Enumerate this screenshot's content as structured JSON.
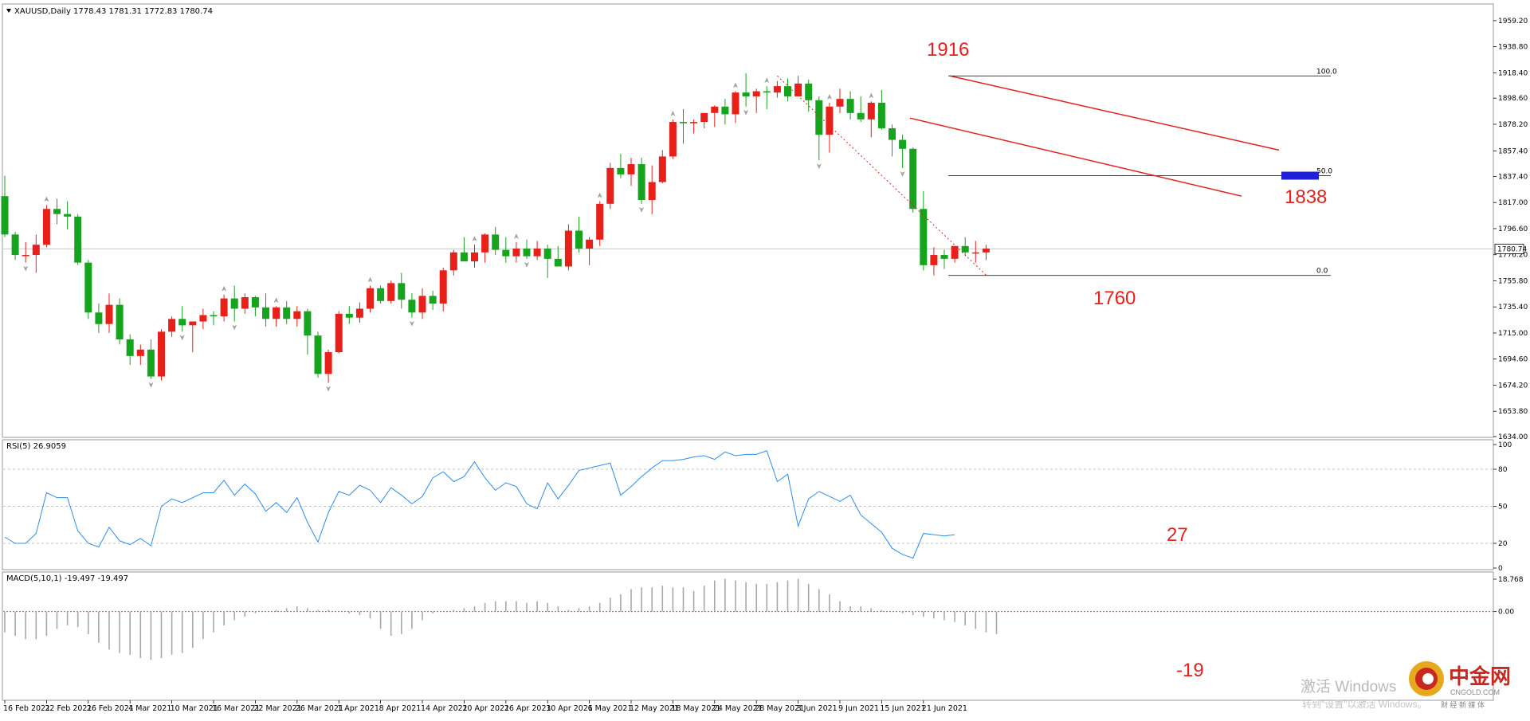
{
  "header": {
    "symbol_timeframe": "XAUUSD,Daily",
    "ohlc": "1778.43 1781.31 1772.83 1780.74"
  },
  "rsi_label": "RSI(5) 26.9059",
  "macd_label": "MACD(5,10,1) -19.497 -19.497",
  "current_price_label": "1780.74",
  "fib_levels": [
    {
      "label": "100.0",
      "price": 1916
    },
    {
      "label": "50.0",
      "price": 1838
    },
    {
      "label": "0.0",
      "price": 1760
    }
  ],
  "annotations": {
    "high": "1916",
    "target": "1838",
    "low": "1760",
    "rsi_value": "27",
    "macd_value": "-19"
  },
  "watermark": {
    "line1": "激活 Windows",
    "line2": "转到\"设置\"以激活 Windows。"
  },
  "logo": {
    "name": "中金网",
    "sub": "CNGOLD.COM",
    "tagline": "财 经 新 媒 体"
  },
  "colors": {
    "up": "#e8201a",
    "down": "#16a31d",
    "trend_line": "#e8201a",
    "rsi_line": "#2a8ef0",
    "target_box": "#1f1fd8"
  },
  "chart_data": {
    "type": "candlestick",
    "symbol": "XAUUSD",
    "timeframe": "Daily",
    "price_axis_ticks": [
      "1959.20",
      "1938.80",
      "1918.40",
      "1898.60",
      "1878.20",
      "1857.40",
      "1837.40",
      "1817.00",
      "1796.60",
      "1776.20",
      "1755.80",
      "1735.40",
      "1715.00",
      "1694.60",
      "1674.20",
      "1653.80",
      "1634.00"
    ],
    "ylim": [
      1634,
      1966
    ],
    "date_ticks": [
      {
        "label": "16 Feb 2021",
        "index": 0
      },
      {
        "label": "22 Feb 2021",
        "index": 4
      },
      {
        "label": "26 Feb 2021",
        "index": 8
      },
      {
        "label": "4 Mar 2021",
        "index": 12
      },
      {
        "label": "10 Mar 2021",
        "index": 16
      },
      {
        "label": "16 Mar 2021",
        "index": 20
      },
      {
        "label": "22 Mar 2021",
        "index": 24
      },
      {
        "label": "26 Mar 2021",
        "index": 28
      },
      {
        "label": "1 Apr 2021",
        "index": 32
      },
      {
        "label": "8 Apr 2021",
        "index": 36
      },
      {
        "label": "14 Apr 2021",
        "index": 40
      },
      {
        "label": "20 Apr 2021",
        "index": 44
      },
      {
        "label": "26 Apr 2021",
        "index": 48
      },
      {
        "label": "30 Apr 2021",
        "index": 52
      },
      {
        "label": "6 May 2021",
        "index": 56
      },
      {
        "label": "12 May 2021",
        "index": 60
      },
      {
        "label": "18 May 2021",
        "index": 64
      },
      {
        "label": "24 May 2021",
        "index": 68
      },
      {
        "label": "28 May 2021",
        "index": 72
      },
      {
        "label": "3 Jun 2021",
        "index": 76
      },
      {
        "label": "9 Jun 2021",
        "index": 80
      },
      {
        "label": "15 Jun 2021",
        "index": 84
      },
      {
        "label": "21 Jun 2021",
        "index": 88
      }
    ],
    "candles": [
      [
        1822,
        1838,
        1790,
        1792
      ],
      [
        1792,
        1794,
        1772,
        1776
      ],
      [
        1776,
        1786,
        1770,
        1776
      ],
      [
        1776,
        1792,
        1762,
        1784
      ],
      [
        1784,
        1815,
        1782,
        1812
      ],
      [
        1812,
        1820,
        1800,
        1808
      ],
      [
        1808,
        1818,
        1796,
        1806
      ],
      [
        1806,
        1808,
        1768,
        1770
      ],
      [
        1770,
        1772,
        1726,
        1731
      ],
      [
        1731,
        1738,
        1715,
        1722
      ],
      [
        1722,
        1746,
        1715,
        1737
      ],
      [
        1737,
        1742,
        1706,
        1710
      ],
      [
        1710,
        1714,
        1690,
        1697
      ],
      [
        1697,
        1706,
        1690,
        1702
      ],
      [
        1702,
        1710,
        1679,
        1681
      ],
      [
        1681,
        1718,
        1678,
        1716
      ],
      [
        1716,
        1728,
        1712,
        1726
      ],
      [
        1726,
        1736,
        1716,
        1721
      ],
      [
        1721,
        1724,
        1700,
        1724
      ],
      [
        1724,
        1734,
        1718,
        1729
      ],
      [
        1729,
        1732,
        1721,
        1728
      ],
      [
        1728,
        1745,
        1724,
        1742
      ],
      [
        1742,
        1752,
        1724,
        1734
      ],
      [
        1734,
        1746,
        1730,
        1743
      ],
      [
        1743,
        1744,
        1728,
        1735
      ],
      [
        1735,
        1746,
        1720,
        1726
      ],
      [
        1726,
        1736,
        1720,
        1735
      ],
      [
        1735,
        1740,
        1722,
        1726
      ],
      [
        1726,
        1736,
        1720,
        1732
      ],
      [
        1732,
        1734,
        1698,
        1713
      ],
      [
        1713,
        1716,
        1680,
        1683
      ],
      [
        1683,
        1702,
        1676,
        1700
      ],
      [
        1700,
        1732,
        1699,
        1730
      ],
      [
        1730,
        1736,
        1722,
        1727
      ],
      [
        1727,
        1739,
        1723,
        1734
      ],
      [
        1734,
        1752,
        1731,
        1750
      ],
      [
        1750,
        1752,
        1738,
        1740
      ],
      [
        1740,
        1756,
        1738,
        1754
      ],
      [
        1754,
        1762,
        1734,
        1741
      ],
      [
        1741,
        1746,
        1727,
        1731
      ],
      [
        1731,
        1750,
        1726,
        1744
      ],
      [
        1744,
        1748,
        1733,
        1738
      ],
      [
        1738,
        1766,
        1732,
        1764
      ],
      [
        1764,
        1780,
        1760,
        1778
      ],
      [
        1778,
        1790,
        1771,
        1771
      ],
      [
        1771,
        1784,
        1766,
        1778
      ],
      [
        1778,
        1793,
        1770,
        1792
      ],
      [
        1792,
        1798,
        1776,
        1780
      ],
      [
        1780,
        1790,
        1770,
        1775
      ],
      [
        1775,
        1786,
        1770,
        1781
      ],
      [
        1781,
        1788,
        1773,
        1775
      ],
      [
        1775,
        1787,
        1772,
        1781
      ],
      [
        1781,
        1784,
        1758,
        1773
      ],
      [
        1773,
        1783,
        1767,
        1767
      ],
      [
        1767,
        1800,
        1764,
        1795
      ],
      [
        1795,
        1806,
        1778,
        1781
      ],
      [
        1781,
        1790,
        1768,
        1788
      ],
      [
        1788,
        1818,
        1783,
        1816
      ],
      [
        1816,
        1848,
        1812,
        1844
      ],
      [
        1844,
        1855,
        1836,
        1839
      ],
      [
        1839,
        1852,
        1830,
        1847
      ],
      [
        1847,
        1852,
        1816,
        1819
      ],
      [
        1819,
        1846,
        1808,
        1833
      ],
      [
        1833,
        1858,
        1832,
        1853
      ],
      [
        1853,
        1882,
        1851,
        1880
      ],
      [
        1880,
        1890,
        1863,
        1879
      ],
      [
        1879,
        1882,
        1871,
        1880
      ],
      [
        1880,
        1886,
        1875,
        1887
      ],
      [
        1887,
        1893,
        1876,
        1892
      ],
      [
        1892,
        1898,
        1878,
        1886
      ],
      [
        1886,
        1904,
        1879,
        1903
      ],
      [
        1903,
        1918,
        1892,
        1900
      ],
      [
        1900,
        1906,
        1887,
        1904
      ],
      [
        1904,
        1908,
        1890,
        1903
      ],
      [
        1903,
        1912,
        1899,
        1908
      ],
      [
        1908,
        1914,
        1896,
        1900
      ],
      [
        1900,
        1916,
        1900,
        1910
      ],
      [
        1910,
        1913,
        1888,
        1897
      ],
      [
        1897,
        1900,
        1850,
        1870
      ],
      [
        1870,
        1895,
        1856,
        1892
      ],
      [
        1892,
        1906,
        1887,
        1898
      ],
      [
        1898,
        1904,
        1882,
        1887
      ],
      [
        1887,
        1900,
        1880,
        1882
      ],
      [
        1882,
        1896,
        1868,
        1895
      ],
      [
        1895,
        1905,
        1874,
        1875
      ],
      [
        1875,
        1878,
        1853,
        1866
      ],
      [
        1866,
        1870,
        1844,
        1859
      ],
      [
        1859,
        1860,
        1809,
        1812
      ],
      [
        1812,
        1826,
        1764,
        1768
      ],
      [
        1768,
        1782,
        1760,
        1776
      ],
      [
        1776,
        1780,
        1765,
        1773
      ],
      [
        1773,
        1783,
        1770,
        1783
      ],
      [
        1783,
        1790,
        1775,
        1778
      ],
      [
        1778,
        1787,
        1770,
        1778
      ],
      [
        1778,
        1784,
        1772,
        1781
      ]
    ],
    "rsi": {
      "name": "RSI(5)",
      "levels": [
        20,
        50,
        80
      ],
      "ylim": [
        0,
        100
      ],
      "tick_labels": [
        "100",
        "80",
        "50",
        "20",
        "0"
      ],
      "values": [
        25,
        20,
        20,
        28,
        61,
        57,
        57,
        30,
        20,
        17,
        33,
        22,
        19,
        24,
        18,
        50,
        56,
        53,
        57,
        61,
        61,
        71,
        59,
        68,
        60,
        46,
        53,
        45,
        57,
        37,
        21,
        45,
        62,
        59,
        67,
        63,
        53,
        65,
        59,
        52,
        58,
        73,
        78,
        70,
        74,
        86,
        73,
        63,
        69,
        66,
        52,
        48,
        69,
        56,
        67,
        79,
        81,
        83,
        85,
        59,
        66,
        74,
        81,
        87,
        87,
        88,
        90,
        91,
        88,
        94,
        91,
        92,
        92,
        95,
        70,
        76,
        34,
        56,
        62,
        58,
        54,
        59,
        43,
        36,
        29,
        16,
        11,
        8,
        28,
        27,
        26,
        27
      ]
    },
    "macd": {
      "name": "MACD(5,10,1)",
      "ylim": [
        -50,
        18.768
      ],
      "tick_labels": [
        "18.768",
        "0.00"
      ],
      "values": [
        -12,
        -14,
        -16,
        -16,
        -14,
        -10,
        -8,
        -9,
        -13,
        -18,
        -22,
        -24,
        -25,
        -27,
        -28,
        -27,
        -25,
        -24,
        -21,
        -16,
        -12,
        -8,
        -5,
        -3,
        -1,
        0,
        1,
        2,
        3,
        2,
        1,
        1,
        0,
        -1,
        -2,
        -4,
        -10,
        -14,
        -13,
        -10,
        -5,
        -1,
        0,
        1,
        2,
        3,
        5,
        6,
        6,
        6,
        5,
        6,
        5,
        3,
        1,
        2,
        3,
        5,
        8,
        10,
        13,
        14,
        14,
        15,
        14,
        14,
        12,
        15,
        18,
        19,
        18,
        17,
        16,
        16,
        17,
        18,
        19,
        16,
        13,
        10,
        6,
        3,
        3,
        2,
        1,
        0,
        -1,
        -2,
        -3,
        -4,
        -5,
        -6,
        -8,
        -10,
        -12,
        -13
      ]
    }
  }
}
